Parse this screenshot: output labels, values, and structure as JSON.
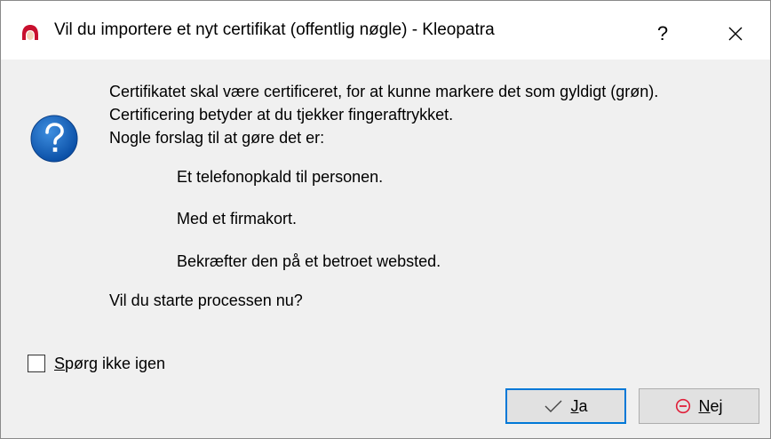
{
  "window": {
    "title": "Vil du importere et nyt certifikat (offentlig nøgle) - Kleopatra",
    "help_label": "?",
    "accent_color": "#0078d7"
  },
  "message": {
    "line1": "Certifikatet skal være certificeret, for at kunne markere det som gyldigt (grøn).",
    "line2": "Certificering betyder at du tjekker fingeraftrykket.",
    "line3": "Nogle forslag til at gøre det er:",
    "suggestions": [
      "Et telefonopkald til personen.",
      "Med et firmakort.",
      "Bekræfter den på et betroet websted."
    ],
    "question": "Vil du starte processen nu?"
  },
  "checkbox": {
    "mnemonic": "S",
    "label_rest": "pørg ikke igen",
    "checked": false
  },
  "buttons": {
    "ja": {
      "mnemonic": "J",
      "rest": "a",
      "icon": "checkmark-icon"
    },
    "nej": {
      "mnemonic": "N",
      "rest": "ej",
      "icon": "cancel-circle-icon",
      "icon_color": "#e0203a"
    }
  }
}
